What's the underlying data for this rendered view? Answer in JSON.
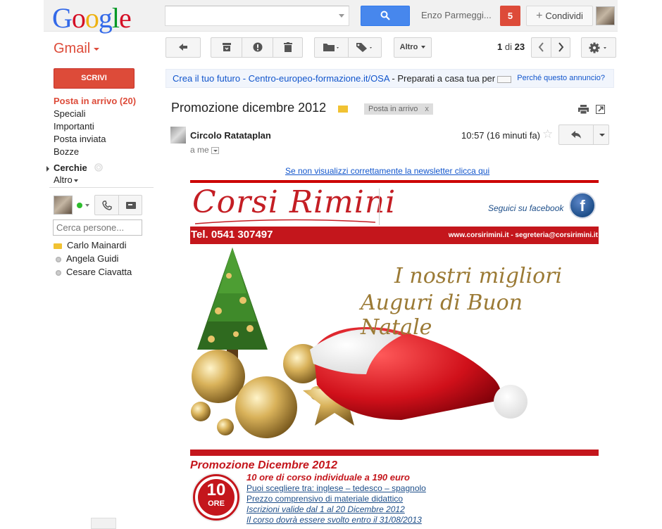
{
  "header": {
    "logo_letters": [
      "G",
      "o",
      "o",
      "g",
      "l",
      "e"
    ],
    "search": {
      "value": "",
      "placeholder": ""
    },
    "user_name": "Enzo Parmeggi...",
    "notifications": "5",
    "share_label": "Condividi",
    "share_plus": "+"
  },
  "toolbar": {
    "app_label": "Gmail",
    "more_label": "Altro",
    "pager": {
      "current": "1",
      "separator": "di",
      "total": "23"
    }
  },
  "sidebar": {
    "compose_label": "SCRIVI",
    "items": [
      {
        "label": "Posta in arrivo (20)",
        "active": true
      },
      {
        "label": "Speciali",
        "active": false
      },
      {
        "label": "Importanti",
        "active": false
      },
      {
        "label": "Posta inviata",
        "active": false
      },
      {
        "label": "Bozze",
        "active": false
      }
    ],
    "circles_label": "Cerchie",
    "more_label": "Altro",
    "people_search_placeholder": "Cerca persone...",
    "contacts": [
      {
        "name": "Carlo Mainardi",
        "status": "video"
      },
      {
        "name": "Angela Guidi",
        "status": "offline"
      },
      {
        "name": "Cesare Ciavatta",
        "status": "offline"
      }
    ]
  },
  "ad": {
    "link_text": "Crea il tuo futuro - Centro-europeo-formazione.it/OSA",
    "body_text": " - Preparati a casa tua per",
    "why_text": "Perché questo annuncio?"
  },
  "message": {
    "subject": "Promozione dicembre 2012",
    "label_chip": "Posta in arrivo",
    "label_remove": "x",
    "sender": "Circolo Ratataplan",
    "to": "a me",
    "time": "10:57 (16 minuti fa)"
  },
  "newsletter": {
    "view_link": "Se non visualizzi correttamente la newsletter clicca qui",
    "brand": "Corsi Rimini",
    "facebook_label": "Seguici su facebook",
    "facebook_glyph": "f",
    "phone": "Tel. 0541 307497",
    "web_contacts": "www.corsirimini.it - segreteria@corsirimini.it",
    "greeting_line1": "I nostri migliori",
    "greeting_line2": "Auguri di Buon Natale",
    "promo_title": "Promozione Dicembre 2012",
    "badge_number": "10",
    "badge_unit": "ORE",
    "promo_headline": "10 ore di corso individuale a 190 euro",
    "promo_lines": [
      "Puoi scegliere tra: inglese – tedesco – spagnolo",
      "Prezzo comprensivo di materiale didattico",
      "Iscrizioni valide dal 1 al 20 Dicembre 2012",
      "Il corso dovrà essere svolto entro il 31/08/2013"
    ]
  },
  "colors": {
    "gmail_red": "#dd4b39",
    "search_blue": "#4787ed",
    "brand_red": "#c4161c",
    "link_blue": "#1155cc",
    "greeting_gold": "#9b7a35"
  }
}
